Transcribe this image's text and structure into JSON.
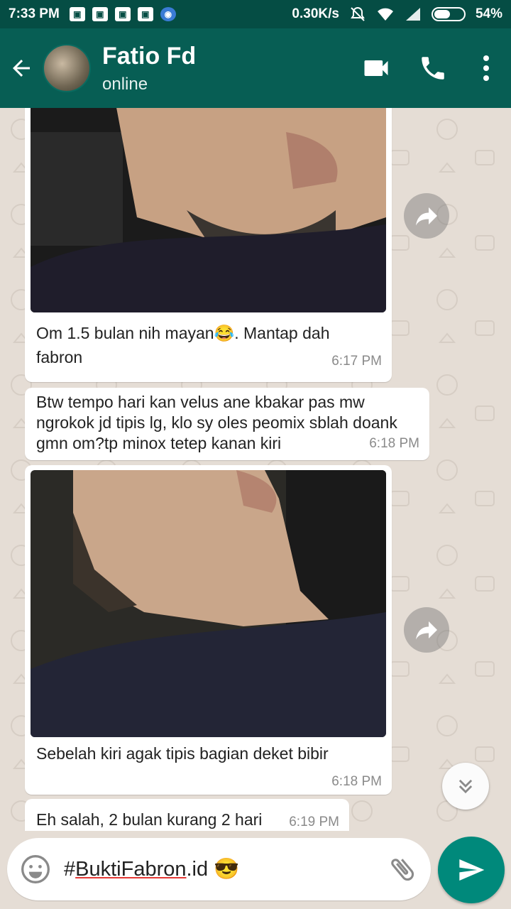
{
  "status_bar": {
    "time": "7:33 PM",
    "net_speed": "0.30K/s",
    "battery": "54%",
    "battery_level": 0.54
  },
  "header": {
    "contact_name": "Fatio Fd",
    "status": "online"
  },
  "messages": [
    {
      "text": "Om 1.5 bulan nih mayan😂. Mantap dah fabron",
      "time": "6:17 PM"
    },
    {
      "text": "Btw tempo hari kan velus ane kbakar pas mw ngrokok jd tipis lg, klo sy oles peomix sblah doank gmn om?tp minox tetep kanan kiri",
      "time": "6:18 PM"
    },
    {
      "text": "Sebelah kiri agak tipis bagian deket bibir",
      "time": "6:18 PM"
    },
    {
      "text": "Eh salah, 2 bulan kurang 2 hari",
      "time": "6:19 PM"
    }
  ],
  "composer": {
    "hash": "#",
    "underlined": "BuktiFabron",
    "suffix": ".id",
    "emoji": "😎"
  },
  "colors": {
    "header": "#075e54",
    "status_bar": "#054d44",
    "send": "#00897b",
    "chat_bg": "#e5ddd5"
  },
  "icons": [
    "back-arrow-icon",
    "video-call-icon",
    "phone-icon",
    "more-vert-icon",
    "forward-icon",
    "chevron-down-icon",
    "emoji-icon",
    "attach-icon",
    "send-icon"
  ]
}
